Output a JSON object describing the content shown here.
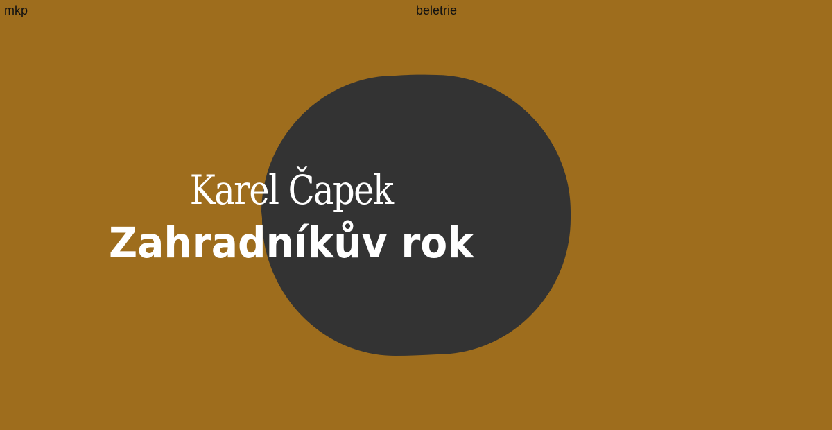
{
  "cover": {
    "publisher": "mkp",
    "category": "beletrie",
    "author": "Karel Čapek",
    "title": "Zahradníkův rok"
  },
  "colors": {
    "background": "#9E6D1D",
    "blob": "#333333",
    "text_light": "#FFFFFF",
    "text_dark": "#111111"
  }
}
